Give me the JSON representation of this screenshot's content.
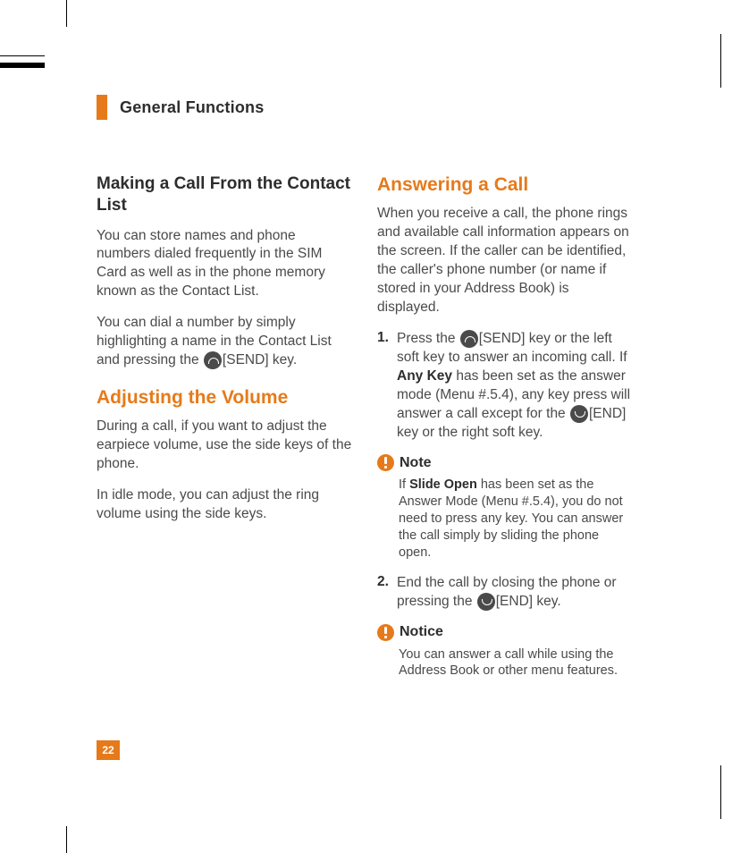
{
  "header": {
    "title": "General Functions"
  },
  "left": {
    "section1": {
      "heading": "Making a Call From the Contact List",
      "p1": "You can store names and phone numbers dialed frequently in the SIM Card as well as in the phone memory known as the Contact List.",
      "p2_a": "You can dial a number by simply highlighting a name in the Contact List and pressing the ",
      "p2_key": "[SEND] key."
    },
    "section2": {
      "heading": "Adjusting the Volume",
      "p1": "During a call, if you want to adjust the earpiece volume, use the side keys of the phone.",
      "p2": "In idle mode, you can adjust the ring volume using the side keys."
    }
  },
  "right": {
    "section1": {
      "heading": "Answering a Call",
      "p1": "When you receive a call, the phone rings and available call information appears on the screen. If the caller can be identified, the caller's phone number (or name if stored in your Address Book) is displayed."
    },
    "item1": {
      "num": "1.",
      "a": "Press the ",
      "b": "[SEND] key or the left soft key to answer an incoming call. If ",
      "c_bold": "Any Key",
      "d": " has been set as the answer mode (Menu #.5.4), any key press will answer a call except for the ",
      "e": "[END] key or the right soft key."
    },
    "note1": {
      "label": "Note",
      "a": "If ",
      "b_bold": "Slide Open",
      "c": " has been set as the Answer Mode (Menu #.5.4), you do not need to press any key. You can answer the call simply by sliding the phone open."
    },
    "item2": {
      "num": "2.",
      "a": "End the call by closing the phone or pressing the ",
      "b": "[END] key."
    },
    "notice": {
      "label": "Notice",
      "text": "You can answer a call while using the Address Book or other menu features."
    }
  },
  "page_number": "22"
}
